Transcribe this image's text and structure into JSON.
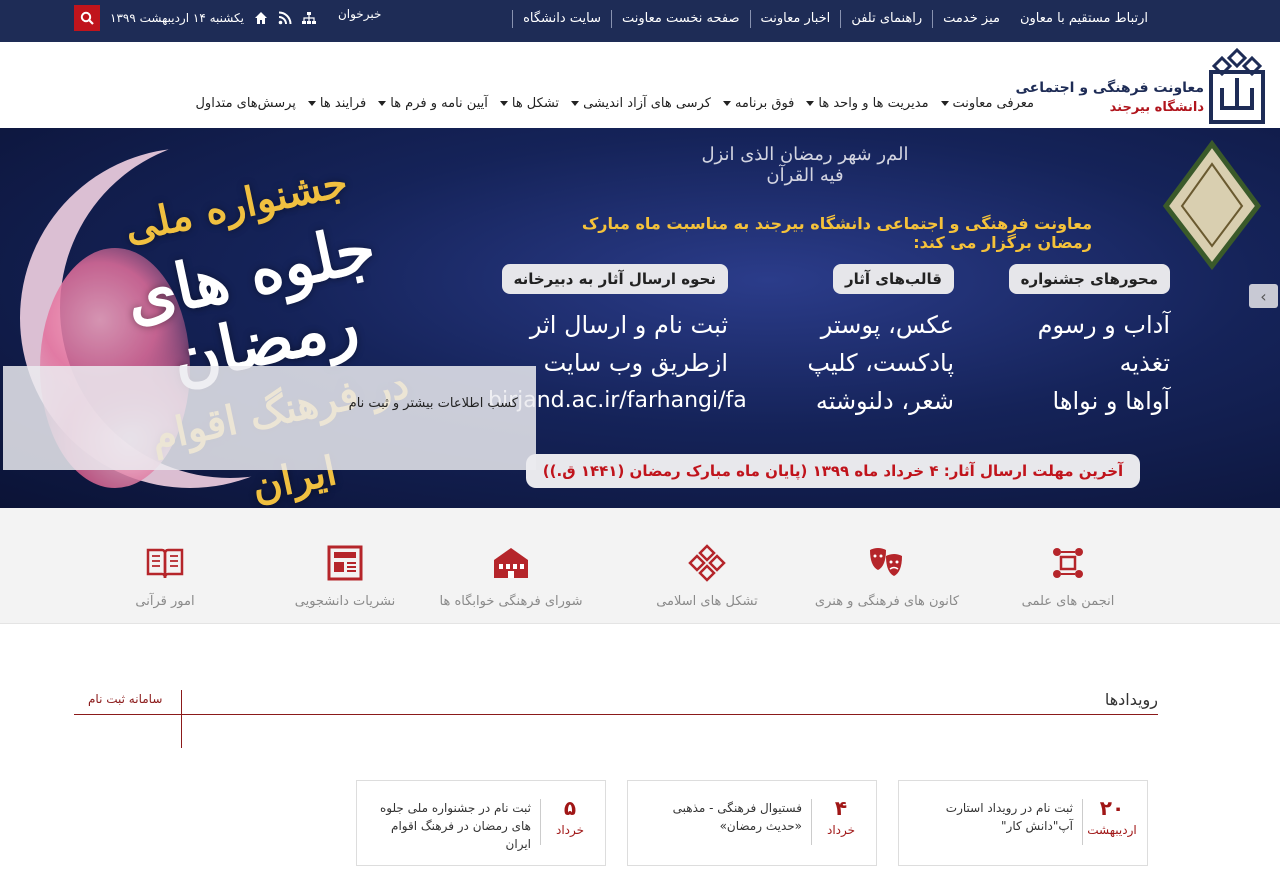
{
  "topbar": {
    "links": [
      "سایت دانشگاه",
      "صفحه نخست معاونت",
      "اخبار معاونت",
      "راهنمای تلفن",
      "میز خدمت",
      "ارتباط مستقیم با معاون"
    ],
    "date": "یکشنبه ۱۴ اردیبهشت ۱۳۹۹",
    "newsreader": "خبرخوان"
  },
  "brand": {
    "title": "معاونت فرهنگی و اجتماعی",
    "subtitle": "دانشگاه بیرجند"
  },
  "nav": {
    "items": [
      "معرفی معاونت",
      "مدیریت ها و واحد ها",
      "فوق برنامه",
      "کرسی های آزاد اندیشی",
      "تشکل ها",
      "آیین نامه و فرم ها",
      "فرایند ها",
      "پرسش‌های متداول"
    ]
  },
  "banner": {
    "arabic_top": "الم‌ر شهر رمضان الذی انزل فیه القرآن",
    "headline": "معاونت فرهنگی و اجتماعی دانشگاه بیرجند به مناسبت ماه مبارک رمضان برگزار می کند:",
    "calligraphy_main": "جلوه های رمضان",
    "calligraphy_festival": "جشنواره ملی",
    "calligraphy_bottom": "در فرهنگ اقوام ایران",
    "columns": [
      {
        "pill": "محورهای جشنواره",
        "lines": [
          "آداب و رسوم",
          "تغذیه",
          "آواها و نواها"
        ]
      },
      {
        "pill": "قالب‌های آثار",
        "lines": [
          "عکس، پوستر",
          "پادکست، کلیپ",
          "شعر، دلنوشته"
        ]
      },
      {
        "pill": "نحوه ارسال آثار به دبیرخانه",
        "lines": [
          "ثبت نام و ارسال اثر",
          "ازطریق وب سایت",
          "birjand.ac.ir/farhangi/fa"
        ]
      }
    ],
    "deadline": "آخرین مهلت ارسال آثار: ۴ خرداد ماه ۱۳۹۹ (پایان ماه مبارک رمضان (۱۴۴۱ ق.))",
    "caption": "کسب اطلاعات بیشتر و ثبت نام"
  },
  "quick_links": [
    "انجمن های علمی",
    "کانون های فرهنگی و هنری",
    "تشکل های اسلامی",
    "شورای فرهنگی خوابگاه ها",
    "نشریات دانشجویی",
    "امور قرآنی"
  ],
  "events": {
    "title": "رویدادها",
    "registration_link": "سامانه ثبت نام",
    "items": [
      {
        "day": "۲۰",
        "month": "اردیبهشت",
        "title": "ثبت نام در رویداد استارت آپ\"دانش کار\""
      },
      {
        "day": "۴",
        "month": "خرداد",
        "title": "فستیوال فرهنگی - مذهبی «حدیث رمضان»"
      },
      {
        "day": "۵",
        "month": "خرداد",
        "title": "ثبت نام در جشنواره ملی جلوه های رمضان در فرهنگ اقوام ایران"
      }
    ]
  },
  "colors": {
    "topbar": "#1e2c56",
    "accent": "#c0141c",
    "brand_red": "#b0141c",
    "event_red": "#a01616"
  }
}
